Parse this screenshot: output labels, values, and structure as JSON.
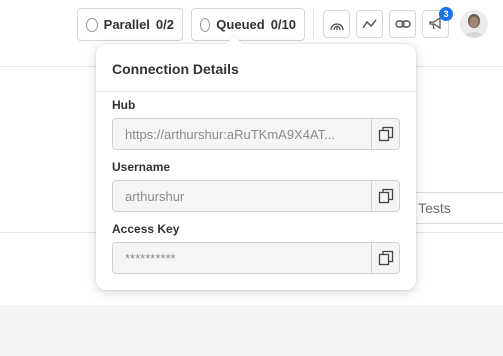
{
  "topbar": {
    "parallel_label": "Parallel",
    "parallel_count": "0/2",
    "queued_label": "Queued",
    "queued_count": "0/10",
    "notification_count": "3"
  },
  "background": {
    "search_placeholder": "rch Tests"
  },
  "connection": {
    "title": "Connection Details",
    "hub_label": "Hub",
    "hub_value": "https://arthurshur:aRuTKmA9X4AT...",
    "username_label": "Username",
    "username_value": "arthurshur",
    "access_key_label": "Access Key",
    "access_key_value": "**********"
  },
  "icons": {
    "status": "circle-outline-icon",
    "bandwidth": "signal-arcs-icon",
    "analytics": "line-trend-icon",
    "link": "link-icon",
    "announcements": "megaphone-icon",
    "copy": "copy-icon"
  },
  "colors": {
    "accent": "#1a73e8",
    "field_bg": "#f5f5f5",
    "border": "#d0d0d0"
  }
}
